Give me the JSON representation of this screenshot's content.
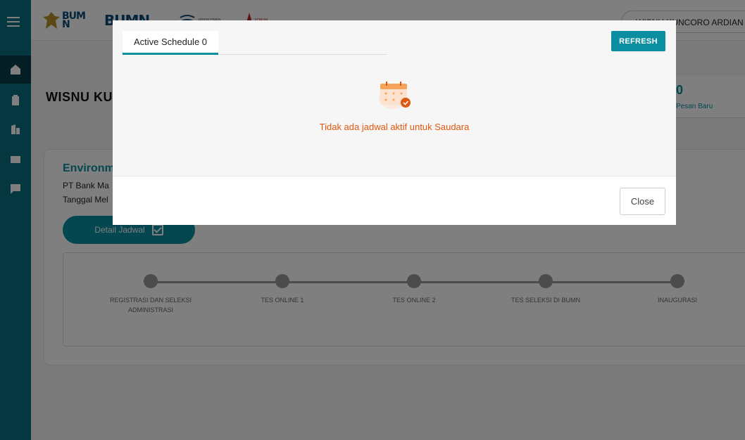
{
  "header": {
    "logos": [
      "BUMN",
      "BUMN",
      "REKRUTMEN",
      "FORUM"
    ],
    "user_name": "WISNU KUNCORO ARDIAN"
  },
  "sidebar": {
    "items": [
      {
        "icon": "home-icon"
      },
      {
        "icon": "clipboard-icon"
      },
      {
        "icon": "building-icon"
      },
      {
        "icon": "mail-icon"
      },
      {
        "icon": "chat-icon"
      }
    ]
  },
  "main": {
    "greeting_name": "WISNU KU",
    "stats": {
      "value": "0",
      "label": "Pesan Baru"
    },
    "card": {
      "title": "Environm",
      "company": "PT Bank Ma",
      "date_label": "Tanggal Mel",
      "detail_button": "Detail Jadwal",
      "steps": [
        "REGISTRASI DAN SELEKSI ADMINISTRASI",
        "TES ONLINE 1",
        "TES ONLINE 2",
        "TES SELEKSI DI BUMN",
        "INAUGURASI"
      ]
    }
  },
  "modal": {
    "tab_label": "Active Schedule 0",
    "refresh_label": "REFRESH",
    "empty_message": "Tidak ada jadwal aktif untuk Saudara",
    "close_label": "Close"
  },
  "colors": {
    "accent": "#0a8ea0",
    "sidebar": "#0a6e80",
    "empty_text": "#e2570f"
  }
}
